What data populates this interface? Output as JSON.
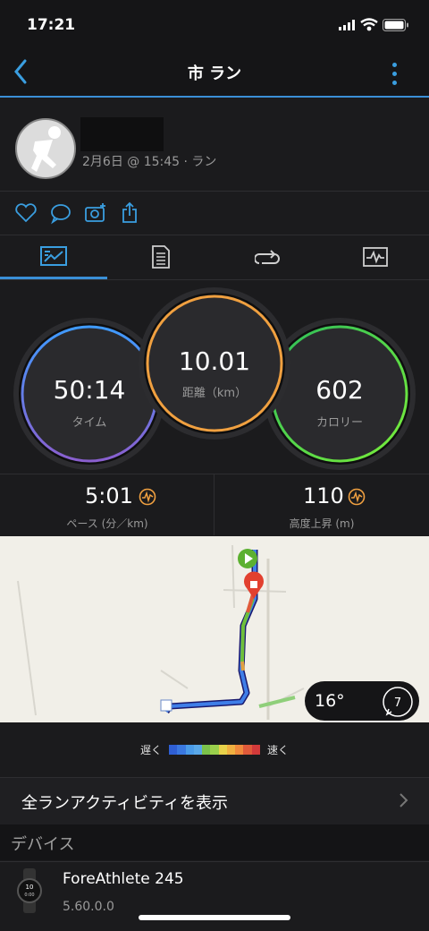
{
  "status": {
    "time": "17:21"
  },
  "nav": {
    "title": "市 ラン"
  },
  "activity": {
    "meta": "2月6日 @ 15:45 · ラン"
  },
  "tabs": [
    {
      "icon": "overview-icon"
    },
    {
      "icon": "details-icon"
    },
    {
      "icon": "laps-icon"
    },
    {
      "icon": "chart-icon"
    }
  ],
  "rings": {
    "time": {
      "value": "50:14",
      "label": "タイム"
    },
    "distance": {
      "value": "10.01",
      "label": "距離（km）"
    },
    "calories": {
      "value": "602",
      "label": "カロリー"
    }
  },
  "stats": {
    "pace": {
      "value": "5:01",
      "label": "ペース (分／km)"
    },
    "elevation": {
      "value": "110",
      "label": "高度上昇 (m)"
    }
  },
  "map": {
    "temperature": "16°",
    "wind": "7"
  },
  "legend": {
    "slow": "遅く",
    "fast": "速く",
    "colors": [
      "#2f5fd4",
      "#3a78e0",
      "#4a9be8",
      "#5aa8e8",
      "#7bc24a",
      "#9ad04c",
      "#e8d24a",
      "#f0b040",
      "#f08a3c",
      "#e05a3a",
      "#d23a3a"
    ]
  },
  "links": {
    "all_runs": "全ランアクティビティを表示"
  },
  "devices": {
    "header": "デバイス",
    "name": "ForeAthlete 245",
    "version": "5.60.0.0"
  },
  "colors": {
    "accent": "#3a8fd6",
    "time_ring": "#6a5bd8",
    "distance_ring": "#f0a040",
    "calories_ring": "#4ade4a"
  }
}
